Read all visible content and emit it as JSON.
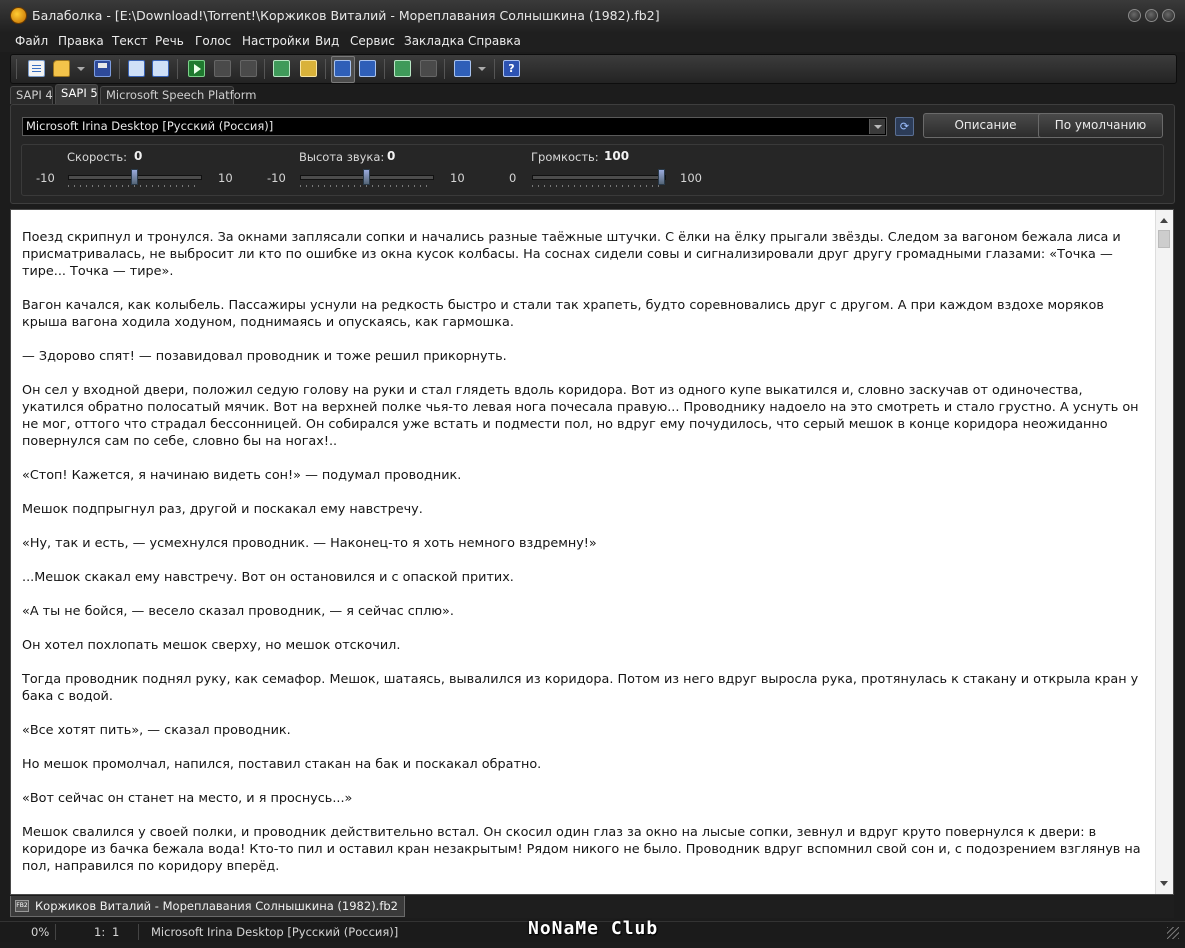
{
  "window": {
    "title": "Балаболка - [E:\\Download!\\Torrent!\\Коржиков Виталий - Мореплавания Солнышкина (1982).fb2]"
  },
  "menu": [
    "Файл",
    "Правка",
    "Текст",
    "Речь",
    "Голос",
    "Настройки",
    "Вид",
    "Сервис",
    "Закладка",
    "Справка"
  ],
  "toolbar": {
    "icons": [
      "new-document",
      "open-folder",
      "save",
      "export-1",
      "export-2",
      "play",
      "pause",
      "stop",
      "read-clipboard",
      "read-file",
      "voice-settings",
      "dictionary",
      "convert",
      "convert-2",
      "spelling",
      "help"
    ]
  },
  "engine_tabs": [
    "SAPI 4",
    "SAPI 5",
    "Microsoft Speech Platform"
  ],
  "engine_tabs_active": "SAPI 5",
  "voice": {
    "selected": "Microsoft Irina Desktop [Русский (Россия)]",
    "describe_label": "Описание",
    "default_label": "По умолчанию"
  },
  "sliders": {
    "rate": {
      "label": "Скорость:",
      "value": "0",
      "min": "-10",
      "max": "10",
      "fraction": 0.5
    },
    "pitch": {
      "label": "Высота звука:",
      "value": "0",
      "min": "-10",
      "max": "10",
      "fraction": 0.5
    },
    "volume": {
      "label": "Громкость:",
      "value": "100",
      "min": "0",
      "max": "100",
      "fraction": 1.0
    }
  },
  "document": {
    "paragraphs": [
      "Поезд скрипнул и тронулся. За окнами заплясали сопки и начались разные таёжные штучки. С ёлки на ёлку прыгали звёзды. Следом за вагоном бежала лиса и присматривалась, не выбросит ли кто по ошибке из окна кусок колбасы. На соснах сидели совы и сигнализировали друг другу громадными глазами: «Точка — тире... Точка — тире».",
      "Вагон качался, как колыбель. Пассажиры уснули на редкость быстро и стали так храпеть, будто соревновались друг с другом. А при каждом вздохе моряков крыша вагона ходила ходуном, поднимаясь и опускаясь, как гармошка.",
      "— Здорово спят! — позавидовал проводник и тоже решил прикорнуть.",
      "Он сел у входной двери, положил седую голову на руки и стал глядеть вдоль коридора. Вот из одного купе выкатился и, словно заскучав от одиночества, укатился обратно полосатый мячик. Вот на верхней полке чья-то левая нога почесала правую... Проводнику надоело на это смотреть и стало грустно. А уснуть он не мог, оттого что страдал бессонницей. Он собирался уже встать и подмести пол, но вдруг ему почудилось, что серый мешок в конце коридора неожиданно повернулся сам по себе, словно бы на ногах!..",
      "«Стоп! Кажется, я начинаю видеть сон!» — подумал проводник.",
      "Мешок подпрыгнул раз, другой и поскакал ему навстречу.",
      "«Ну, так и есть, — усмехнулся проводник. — Наконец-то я хоть немного вздремну!»",
      "...Мешок скакал ему навстречу. Вот он остановился и с опаской притих.",
      "«А ты не бойся, — весело сказал проводник, — я сейчас сплю».",
      "Он хотел похлопать мешок сверху, но мешок отскочил.",
      "Тогда проводник поднял руку, как семафор. Мешок, шатаясь, вывалился из коридора. Потом из него вдруг выросла рука, протянулась к стакану и открыла кран у бака с водой.",
      "«Все хотят пить», — сказал проводник.",
      "Но мешок промолчал, напился, поставил стакан на бак и поскакал обратно.",
      "«Вот сейчас он станет на место, и я проснусь...»",
      "Мешок свалился у своей полки, и проводник действительно встал. Он скосил один глаз за окно на лысые сопки, зевнул и вдруг круто повернулся к двери: в коридоре из бачка бежала вода! Кто-то пил и оставил кран незакрытым! Рядом никого не было. Проводник вдруг вспомнил свой сон и, с подозрением взглянув на пол, направился по коридору вперёд."
    ]
  },
  "doc_tab": {
    "label": "Коржиков Виталий - Мореплавания Солнышкина (1982).fb2",
    "icon": "FB2"
  },
  "status": {
    "progress": "0%",
    "line": "1:",
    "col": "1",
    "voice": "Microsoft Irina Desktop [Русский (Россия)]"
  },
  "watermark": "NoNaMe Club"
}
